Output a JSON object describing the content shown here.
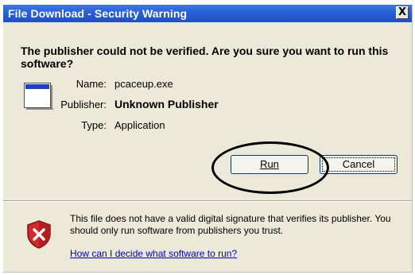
{
  "window": {
    "title": "File Download - Security Warning",
    "close_label": "X"
  },
  "question": "The publisher could not be verified.  Are you sure you want to run this software?",
  "file": {
    "name_label": "Name:",
    "name_value": "pcaceup.exe",
    "publisher_label": "Publisher:",
    "publisher_value": "Unknown Publisher",
    "type_label": "Type:",
    "type_value": "Application",
    "icon": "application-window-icon"
  },
  "buttons": {
    "run_label": "Run",
    "cancel_label": "Cancel"
  },
  "footer": {
    "icon": "shield-x-icon",
    "warning_text": "This file does not have a valid digital signature that verifies its publisher.  You should only run software from publishers you trust.",
    "help_link": "How can I decide what software to run?"
  },
  "colors": {
    "titlebar": "#2a5fd8",
    "dialog_bg": "#ece9d8",
    "link": "#0000cc",
    "shield_red": "#d62828"
  }
}
